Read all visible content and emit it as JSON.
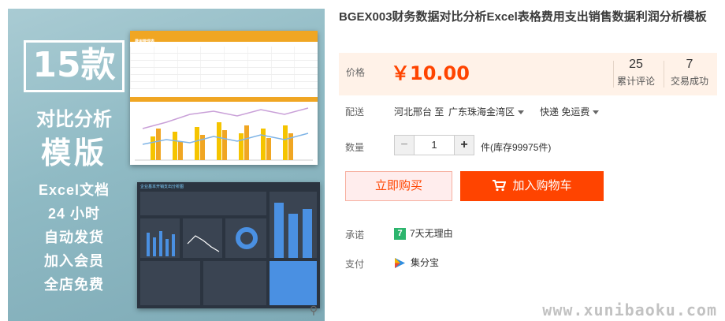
{
  "product": {
    "title": "BGEX003财务数据对比分析Excel表格费用支出销售数据利润分析模板"
  },
  "gallery": {
    "promo_count": "15款",
    "promo_line1": "对比分析",
    "promo_line2": "模版",
    "features": [
      "Excel文档",
      "24 小时",
      "自动发货",
      "加入会员",
      "全店免费"
    ],
    "sheet1_title": "费用管理表",
    "sheet2_title": "企业基本开销支出分析图",
    "zoom_icon": "magnifier-icon"
  },
  "price": {
    "label": "价格",
    "value": "￥10.00",
    "reviews_count": "25",
    "reviews_label": "累计评论",
    "sales_count": "7",
    "sales_label": "交易成功"
  },
  "delivery": {
    "label": "配送",
    "from": "河北邢台 至",
    "to": "广东珠海金湾区",
    "method": "快递 免运费"
  },
  "quantity": {
    "label": "数量",
    "value": "1",
    "minus": "−",
    "plus": "+",
    "stock": "件(库存99975件)"
  },
  "actions": {
    "buy_now": "立即购买",
    "add_to_cart": "加入购物车"
  },
  "promise": {
    "label": "承诺",
    "icon_text": "7",
    "text": "7天无理由"
  },
  "payment": {
    "label": "支付",
    "text": "集分宝"
  },
  "watermark": "www.xunibaoku.com",
  "colors": {
    "accent": "#ff4400",
    "price_bg": "#fff2e8",
    "promise_green": "#2cb56d"
  }
}
